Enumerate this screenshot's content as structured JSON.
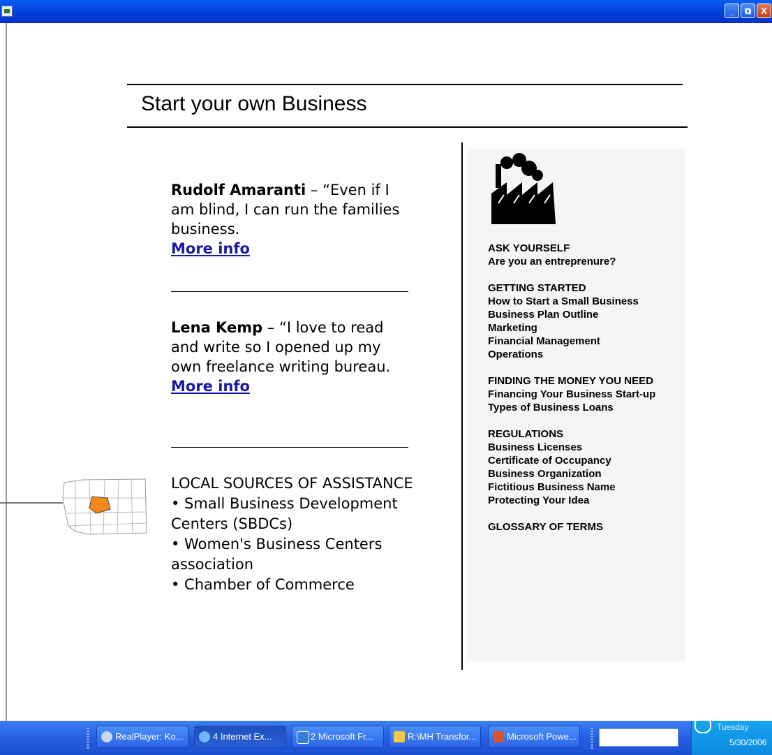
{
  "window": {
    "title": "",
    "buttons": {
      "minimize": "_",
      "maximize": "⧉",
      "close": "X"
    }
  },
  "slide": {
    "heading": "Start your own Business",
    "stories": [
      {
        "name": "Rudolf Amaranti",
        "quote": " – “Even if I am blind, I can run the families business.",
        "link": "More info"
      },
      {
        "name": "Lena Kemp",
        "quote": " – “I love to read and write so I opened up my own freelance writing bureau.",
        "link": "More info"
      }
    ],
    "local": {
      "title": "LOCAL SOURCES OF ASSISTANCE",
      "items": [
        "• Small Business Development Centers (SBDCs)",
        "• Women's Business Centers association",
        "• Chamber of Commerce"
      ]
    }
  },
  "sidebar": {
    "groups": [
      {
        "heading": "ASK YOURSELF",
        "items": [
          "Are you an entreprenure?"
        ]
      },
      {
        "heading": "GETTING STARTED",
        "items": [
          "How to Start a Small Business",
          "Business Plan Outline",
          "Marketing",
          "Financial Management",
          "Operations"
        ]
      },
      {
        "heading": "FINDING THE MONEY YOU NEED",
        "items": [
          "Financing Your Business Start-up",
          "Types of Business Loans"
        ]
      },
      {
        "heading": "REGULATIONS",
        "items": [
          "Business Licenses",
          "Certificate of Occupancy",
          "Business Organization",
          "Fictitious Business Name",
          "Protecting Your Idea"
        ]
      },
      {
        "heading": "GLOSSARY OF TERMS",
        "items": []
      }
    ]
  },
  "taskbar": {
    "tasks": [
      {
        "label": "RealPlayer: Ko...",
        "icon": "realplayer-icon"
      },
      {
        "label": "4 Internet Ex...",
        "icon": "internet-explorer-icon"
      },
      {
        "label": "2 Microsoft Fr...",
        "icon": "frontpage-icon"
      },
      {
        "label": "R:\\MH Transfor...",
        "icon": "folder-icon"
      },
      {
        "label": "Microsoft Powe...",
        "icon": "powerpoint-icon"
      }
    ],
    "clock_day": "Tuesday",
    "clock_date": "5/30/2006"
  }
}
